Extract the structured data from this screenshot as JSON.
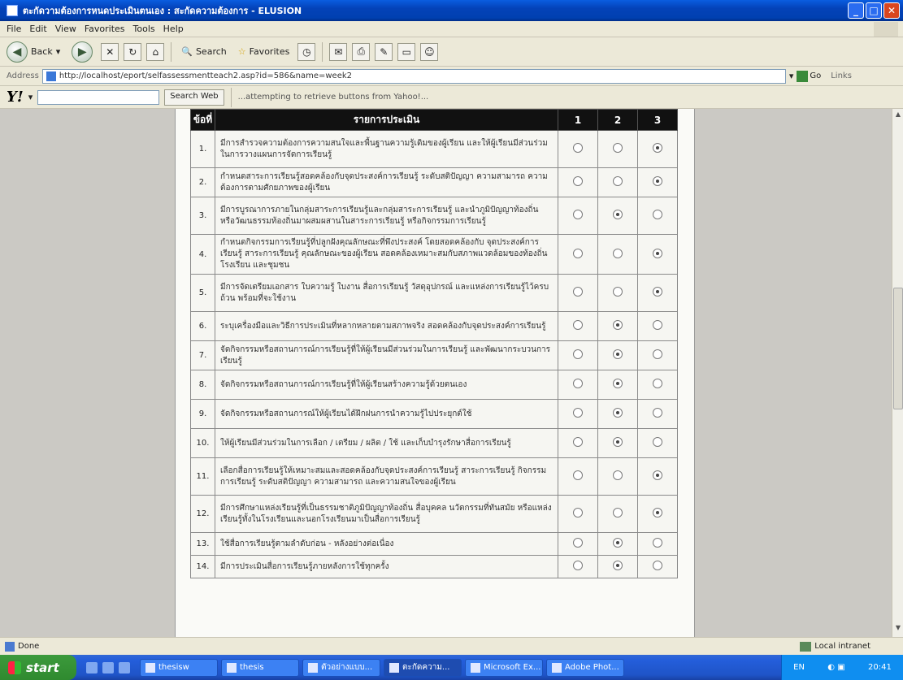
{
  "window": {
    "title": "ตะกัดวามต้องการหนดประเมินตนเอง : สะกัดความต้องการ - ELUSION"
  },
  "menu": [
    "File",
    "Edit",
    "View",
    "Favorites",
    "Tools",
    "Help"
  ],
  "toolbar": {
    "back": "Back",
    "search": "Search",
    "favorites": "Favorites"
  },
  "address": {
    "label": "Address",
    "url": "http://localhost/eport/selfassessmentteach2.asp?id=586&name=week2",
    "go": "Go",
    "links": "Links"
  },
  "yahoo": {
    "logo": "Y!",
    "search_btn": "Search Web",
    "message": "...attempting to retrieve buttons from Yahoo!..."
  },
  "table": {
    "headers": {
      "no": "ข้อที่",
      "item": "รายการประเมิน",
      "c1": "1",
      "c2": "2",
      "c3": "3"
    },
    "rows": [
      {
        "no": "1.",
        "text": "มีการสำรวจความต้องการความสนใจและพื้นฐานความรู้เดิมของผู้เรียน และให้ผู้เรียนมีส่วนร่วมในการวางแผนการจัดการเรียนรู้",
        "sel": 3
      },
      {
        "no": "2.",
        "text": "กำหนดสาระการเรียนรู้สอดคล้องกับจุดประสงค์การเรียนรู้ ระดับสติปัญญา ความสามารถ ความต้องการตามศักยภาพของผู้เรียน",
        "sel": 3
      },
      {
        "no": "3.",
        "text": "มีการบูรณาการภายในกลุ่มสาระการเรียนรู้และกลุ่มสาระการเรียนรู้ และนำภูมิปัญญาท้องถิ่นหรือวัฒนธรรมท้องถิ่นมาผสมผสานในสาระการเรียนรู้ หรือกิจกรรมการเรียนรู้",
        "sel": 2
      },
      {
        "no": "4.",
        "text": "กำหนดกิจกรรมการเรียนรู้ที่ปลูกฝังคุณลักษณะที่พึงประสงค์ โดยสอดคล้องกับ จุดประสงค์การเรียนรู้ สาระการเรียนรู้ คุณลักษณะของผู้เรียน สอดคล้องเหมาะสมกับสภาพแวดล้อมของท้องถิ่น โรงเรียน และชุมชน",
        "sel": 3
      },
      {
        "no": "5.",
        "text": "มีการจัดเตรียมเอกสาร ใบความรู้ ใบงาน สื่อการเรียนรู้ วัสดุอุปกรณ์ และแหล่งการเรียนรู้ไว้ครบถ้วน พร้อมที่จะใช้งาน",
        "sel": 3
      },
      {
        "no": "6.",
        "text": "ระบุเครื่องมือและวิธีการประเมินที่หลากหลายตามสภาพจริง สอดคล้องกับจุดประสงค์การเรียนรู้",
        "sel": 2
      },
      {
        "no": "7.",
        "text": "จัดกิจกรรมหรือสถานการณ์การเรียนรู้ที่ให้ผู้เรียนมีส่วนร่วมในการเรียนรู้ และพัฒนากระบวนการเรียนรู้",
        "sel": 2
      },
      {
        "no": "8.",
        "text": "จัดกิจกรรมหรือสถานการณ์การเรียนรู้ที่ให้ผู้เรียนสร้างความรู้ด้วยตนเอง",
        "sel": 2
      },
      {
        "no": "9.",
        "text": "จัดกิจกรรมหรือสถานการณ์ให้ผู้เรียนได้ฝึกฝนการนำความรู้ไปประยุกต์ใช้",
        "sel": 2
      },
      {
        "no": "10.",
        "text": "ให้ผู้เรียนมีส่วนร่วมในการเลือก / เตรียม / ผลิต / ใช้ และเก็บบำรุงรักษาสื่อการเรียนรู้",
        "sel": 2
      },
      {
        "no": "11.",
        "text": "เลือกสื่อการเรียนรู้ให้เหมาะสมและสอดคล้องกับจุดประสงค์การเรียนรู้ สาระการเรียนรู้ กิจกรรมการเรียนรู้ ระดับสติปัญญา ความสามารถ และความสนใจของผู้เรียน",
        "sel": 3
      },
      {
        "no": "12.",
        "text": "มีการศึกษาแหล่งเรียนรู้ที่เป็นธรรมชาติภูมิปัญญาท้องถิ่น สื่อบุคคล นวัตกรรมที่ทันสมัย หรือแหล่งเรียนรู้ทั้งในโรงเรียนและนอกโรงเรียนมาเป็นสื่อการเรียนรู้",
        "sel": 3
      },
      {
        "no": "13.",
        "text": "ใช้สื่อการเรียนรู้ตามลำดับก่อน - หลังอย่างต่อเนื่อง",
        "sel": 2
      },
      {
        "no": "14.",
        "text": "มีการประเมินสื่อการเรียนรู้ภายหลังการใช้ทุกครั้ง",
        "sel": 2
      }
    ]
  },
  "status": {
    "left": "Done",
    "zone": "Local intranet"
  },
  "taskbar": {
    "start": "start",
    "tasks": [
      "thesisw",
      "thesis",
      "ตัวอย่างแบบ...",
      "ตะกัดความ...",
      "Microsoft Ex...",
      "Adobe Phot..."
    ],
    "active_index": 3,
    "lang": "EN",
    "time": "20:41"
  }
}
